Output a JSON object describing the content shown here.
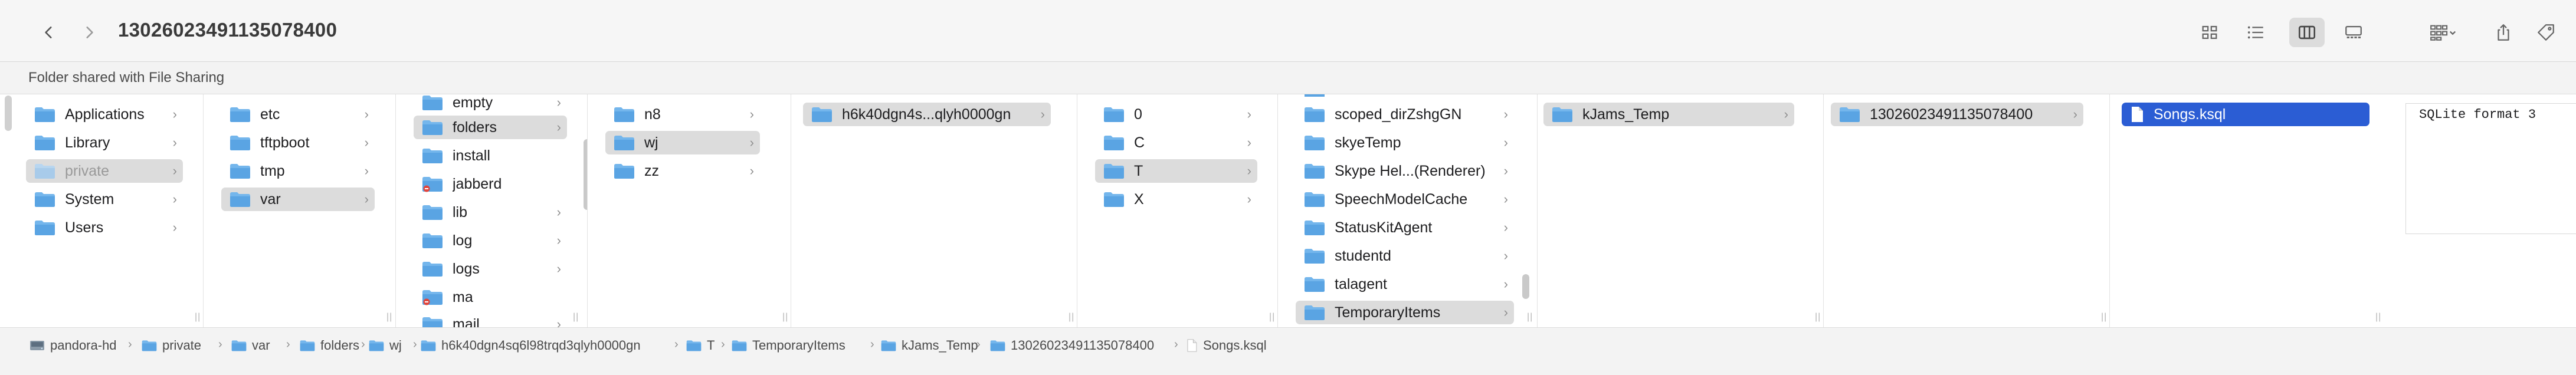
{
  "window": {
    "title": "13026023491135078400"
  },
  "toolbar": {
    "back_icon": "chevron-left-icon",
    "forward_icon": "chevron-right-icon",
    "view_icon": "icon-view-icon",
    "list_icon": "list-view-icon",
    "column_icon": "column-view-icon",
    "gallery_icon": "gallery-view-icon",
    "group_icon": "group-by-icon",
    "share_icon": "share-icon",
    "tag_icon": "tag-icon"
  },
  "infobar": {
    "text": "Folder shared with File Sharing"
  },
  "columns": [
    {
      "items": [
        {
          "label": "Applications",
          "state": ""
        },
        {
          "label": "Library",
          "state": ""
        },
        {
          "label": "private",
          "state": "sel-dim"
        },
        {
          "label": "System",
          "state": ""
        },
        {
          "label": "Users",
          "state": ""
        }
      ]
    },
    {
      "items": [
        {
          "label": "etc",
          "state": ""
        },
        {
          "label": "tftpboot",
          "state": ""
        },
        {
          "label": "tmp",
          "state": ""
        },
        {
          "label": "var",
          "state": "sel"
        }
      ]
    },
    {
      "items": [
        {
          "label": "empty",
          "state": ""
        },
        {
          "label": "folders",
          "state": "sel"
        },
        {
          "label": "install",
          "state": ""
        },
        {
          "label": "jabberd",
          "state": ""
        },
        {
          "label": "lib",
          "state": ""
        },
        {
          "label": "log",
          "state": ""
        },
        {
          "label": "logs",
          "state": ""
        },
        {
          "label": "ma",
          "state": ""
        },
        {
          "label": "mail",
          "state": ""
        }
      ]
    },
    {
      "items": [
        {
          "label": "n8",
          "state": ""
        },
        {
          "label": "wj",
          "state": "sel"
        },
        {
          "label": "zz",
          "state": ""
        }
      ]
    },
    {
      "items": [
        {
          "label": "h6k40dgn4s...qlyh0000gn",
          "state": "sel"
        }
      ]
    },
    {
      "items": [
        {
          "label": "0",
          "state": ""
        },
        {
          "label": "C",
          "state": ""
        },
        {
          "label": "T",
          "state": "sel"
        },
        {
          "label": "X",
          "state": ""
        }
      ]
    },
    {
      "items": [
        {
          "label": "scoped_dirZshgGN",
          "state": ""
        },
        {
          "label": "skyeTemp",
          "state": ""
        },
        {
          "label": "Skype Hel...(Renderer)",
          "state": ""
        },
        {
          "label": "SpeechModelCache",
          "state": ""
        },
        {
          "label": "StatusKitAgent",
          "state": ""
        },
        {
          "label": "studentd",
          "state": ""
        },
        {
          "label": "talagent",
          "state": ""
        },
        {
          "label": "TemporaryItems",
          "state": "sel"
        }
      ]
    },
    {
      "items": [
        {
          "label": "kJams_Temp",
          "state": "sel"
        }
      ]
    },
    {
      "items": [
        {
          "label": "13026023491135078400",
          "state": "sel"
        }
      ]
    },
    {
      "items": [
        {
          "label": "Songs.ksql",
          "state": "blue"
        }
      ]
    }
  ],
  "preview": {
    "text": "SQLite format 3"
  },
  "pathbar": [
    "pandora-hd",
    "private",
    "var",
    "folders",
    "wj",
    "h6k40dgn4sq6l98trqd3qlyh0000gn",
    "T",
    "TemporaryItems",
    "kJams_Temp",
    "13026023491135078400",
    "Songs.ksql"
  ]
}
